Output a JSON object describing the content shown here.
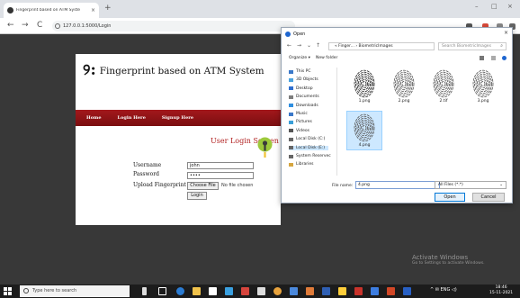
{
  "browser": {
    "tab_title": "Fingerprint based on ATM Syste",
    "tab_close": "×",
    "new_tab": "+",
    "back": "←",
    "forward": "→",
    "reload": "C",
    "url": "127.0.0.1:5000/Login",
    "minimize": "–",
    "maximize": "□",
    "close": "×"
  },
  "site": {
    "logo_glyph": "୨:",
    "title": "Fingerprint based on ATM System",
    "nav": [
      "Home",
      "Login Here",
      "Signup Here"
    ],
    "login_heading": "User Login Screen",
    "username_label": "Username",
    "username_value": "john",
    "password_label": "Password",
    "password_value": "••••",
    "upload_label": "Upload Fingerprint",
    "choose_file": "Choose File",
    "no_file": "No file chosen",
    "login_button": "Login"
  },
  "dialog": {
    "title": "Open",
    "close": "×",
    "breadcrumb": "« Finger... › BiometricImages",
    "search_placeholder": "Search BiometricImages",
    "organize": "Organize ▾",
    "new_folder": "New folder",
    "nav_items": [
      {
        "label": "This PC",
        "color": "#3a78c9"
      },
      {
        "label": "3D Objects",
        "color": "#4aa3df"
      },
      {
        "label": "Desktop",
        "color": "#2f6fd0"
      },
      {
        "label": "Documents",
        "color": "#7d7d7d"
      },
      {
        "label": "Downloads",
        "color": "#2f8fe0"
      },
      {
        "label": "Music",
        "color": "#3a78c9"
      },
      {
        "label": "Pictures",
        "color": "#3a9fd8"
      },
      {
        "label": "Videos",
        "color": "#555555"
      },
      {
        "label": "Local Disk (C:)",
        "color": "#666666"
      },
      {
        "label": "Local Disk (E:)",
        "color": "#666666"
      },
      {
        "label": "System Reservec",
        "color": "#666666"
      },
      {
        "label": "Libraries",
        "color": "#d6a640"
      }
    ],
    "selected_nav": "Local Disk (E:)",
    "files": [
      "1.png",
      "2.png",
      "2.tif",
      "3.png",
      "4.png"
    ],
    "selected_file": "4.png",
    "filename_label": "File name:",
    "filename_value": "4.png",
    "filetype": "All Files (*.*)",
    "open_button": "Open",
    "cancel_button": "Cancel"
  },
  "watermark": {
    "line1": "Activate Windows",
    "line2": "Go to Settings to activate Windows."
  },
  "taskbar": {
    "search_placeholder": "Type here to search",
    "tray": "^ ✉ ENG ◁)",
    "time": "18:46",
    "date": "15-11-2021"
  }
}
